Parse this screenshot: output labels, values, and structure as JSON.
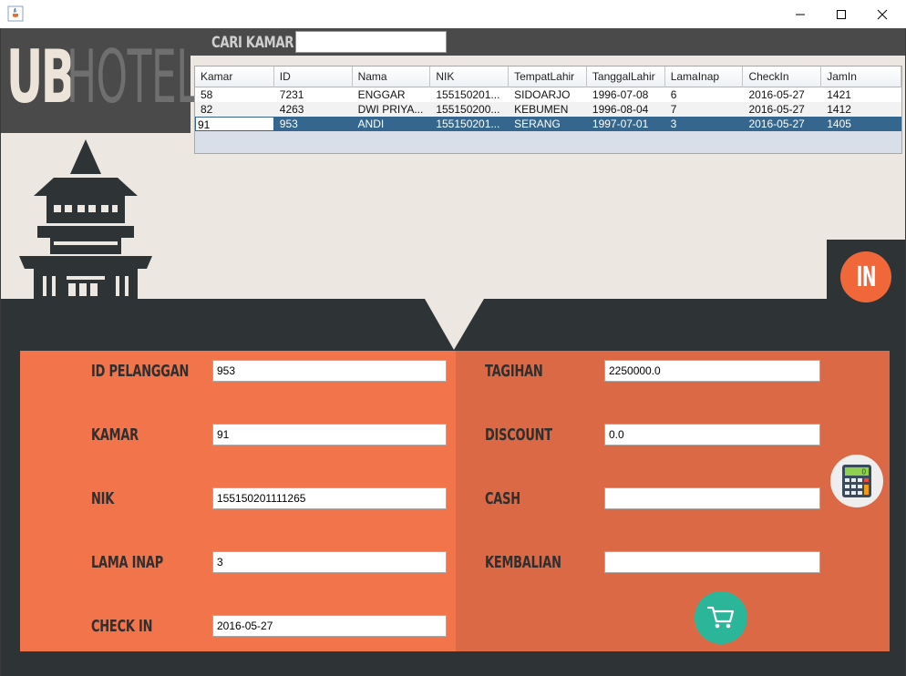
{
  "window": {
    "minimize_symbol": "—",
    "maximize_symbol": "☐",
    "close_symbol": "✕"
  },
  "logo": {
    "part1": "UB",
    "part2": "HOTEL"
  },
  "search": {
    "label": "CARI KAMAR",
    "value": ""
  },
  "table": {
    "columns": [
      "Kamar",
      "ID",
      "Nama",
      "NIK",
      "TempatLahir",
      "TanggalLahir",
      "LamaInap",
      "CheckIn",
      "JamIn"
    ],
    "rows": [
      [
        "58",
        "7231",
        "ENGGAR",
        "155150201...",
        "SIDOARJO",
        "1996-07-08",
        "6",
        "2016-05-27",
        "1421"
      ],
      [
        "82",
        "4263",
        "DWI PRIYA...",
        "155150200...",
        "KEBUMEN",
        "1996-08-04",
        "7",
        "2016-05-27",
        "1412"
      ],
      [
        "91",
        "953",
        "ANDI",
        "155150201...",
        "SERANG",
        "1997-07-01",
        "3",
        "2016-05-27",
        "1405"
      ]
    ],
    "selected_row": 2
  },
  "form": {
    "id_pelanggan": {
      "label": "ID PELANGGAN",
      "value": "953"
    },
    "kamar": {
      "label": "KAMAR",
      "value": "91"
    },
    "nik": {
      "label": "NIK",
      "value": "155150201111265"
    },
    "lama_inap": {
      "label": "LAMA INAP",
      "value": "3"
    },
    "check_in": {
      "label": "CHECK IN",
      "value": "2016-05-27"
    },
    "tagihan": {
      "label": "TAGIHAN",
      "value": "2250000.0"
    },
    "discount": {
      "label": "DISCOUNT",
      "value": "0.0"
    },
    "cash": {
      "label": "CASH",
      "value": ""
    },
    "kembalian": {
      "label": "KEMBALIAN",
      "value": ""
    }
  },
  "buttons": {
    "in_label": "IN",
    "calculator_display": "0",
    "calculator_icon": "calculator-icon",
    "cart_icon": "cart-icon"
  },
  "colors": {
    "orange": "#f2744a",
    "orange_dark": "#dc6945",
    "dark": "#2e3336",
    "teal": "#2bb69a",
    "selection": "#35668e"
  }
}
